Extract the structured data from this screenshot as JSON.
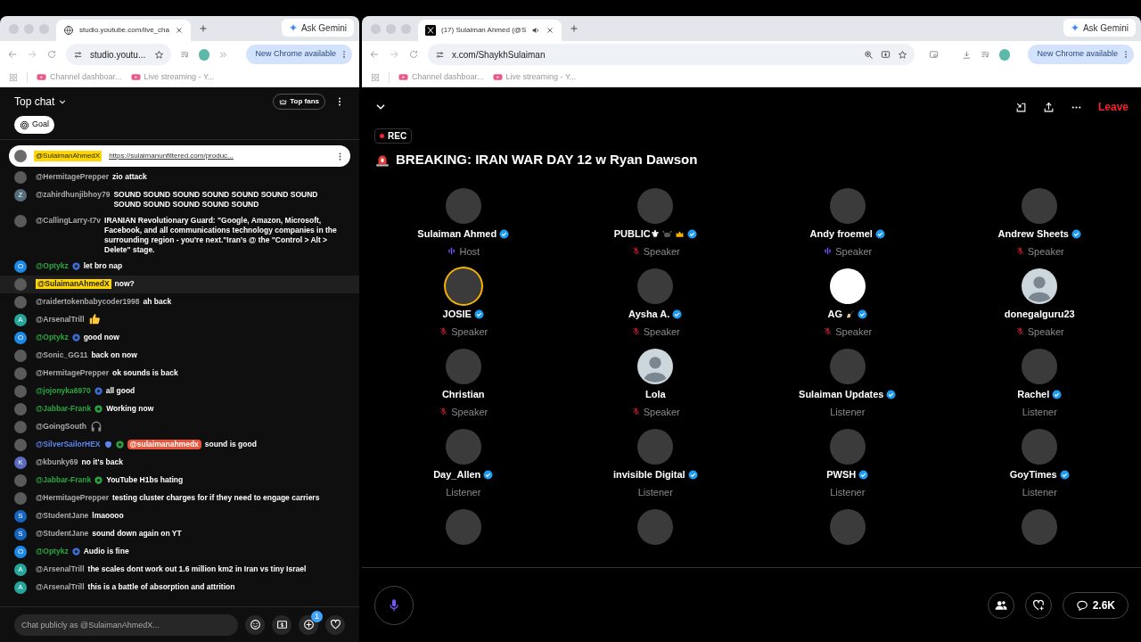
{
  "left_window": {
    "tab_title": "studio.youtube.com/live_cha",
    "ask_gemini": "Ask Gemini",
    "address": "studio.youtu...",
    "update_button": "New Chrome available",
    "bookmarks": [
      "Channel dashboar...",
      "Live streaming - Y..."
    ]
  },
  "chat": {
    "title": "Top chat",
    "top_fans": "Top fans",
    "goal": "Goal",
    "pinned": {
      "author": "@SulaimanAhmedX",
      "link": "https://sulaimanunfiltered.com/produc..."
    },
    "messages": [
      {
        "author": "@HermitagePrepper",
        "kind": "viewer",
        "avatar": {
          "kind": "photo"
        },
        "text": "zio attack"
      },
      {
        "author": "@zahirdhunjibhoy79",
        "kind": "viewer",
        "avatar": {
          "kind": "letter",
          "letter": "Z",
          "color": "#546e7a"
        },
        "text": "SOUND SOUND SOUND SOUND SOUND SOUND SOUND SOUND SOUND SOUND SOUND SOUND"
      },
      {
        "author": "@CallingLarry-t7v",
        "kind": "viewer",
        "avatar": {
          "kind": "photo"
        },
        "text": "IRANIAN Revolutionary Guard: \"Google, Amazon, Microsoft, Facebook, and all communications technology companies in the surrounding region - you're next.\"Iran's @ the \"Control > Alt > Delete\" stage."
      },
      {
        "author": "@Optykz",
        "kind": "member",
        "avatar": {
          "kind": "letter",
          "letter": "O",
          "color": "#1e88e5"
        },
        "badges": [
          {
            "kind": "member",
            "color": "#3d6fd6"
          }
        ],
        "text": "let bro nap"
      },
      {
        "author": "@SulaimanAhmedX",
        "kind": "owner",
        "avatar": {
          "kind": "photo"
        },
        "text": "now?"
      },
      {
        "author": "@raidertokenbabycoder1998",
        "kind": "viewer",
        "avatar": {
          "kind": "photo"
        },
        "text": "ah back"
      },
      {
        "author": "@ArsenalTrill",
        "kind": "viewer",
        "avatar": {
          "kind": "letter",
          "letter": "A",
          "color": "#26a69a"
        },
        "emoji": {
          "kind": "thumbs_up"
        }
      },
      {
        "author": "@Optykz",
        "kind": "member",
        "avatar": {
          "kind": "letter",
          "letter": "O",
          "color": "#1e88e5"
        },
        "badges": [
          {
            "kind": "member",
            "color": "#3d6fd6"
          }
        ],
        "text": "good now"
      },
      {
        "author": "@Sonic_GG11",
        "kind": "viewer",
        "avatar": {
          "kind": "photo"
        },
        "text": "back on now"
      },
      {
        "author": "@HermitagePrepper",
        "kind": "viewer",
        "avatar": {
          "kind": "photo"
        },
        "text": "ok sounds is back"
      },
      {
        "author": "@jojonyka6970",
        "kind": "member",
        "avatar": {
          "kind": "photo"
        },
        "badges": [
          {
            "kind": "member",
            "color": "#3d6fd6"
          }
        ],
        "text": "all good"
      },
      {
        "author": "@Jabbar-Frank",
        "kind": "member",
        "avatar": {
          "kind": "photo"
        },
        "badges": [
          {
            "kind": "member",
            "color": "#2ba640"
          }
        ],
        "text": "Working now"
      },
      {
        "author": "@GoingSouth",
        "kind": "viewer",
        "avatar": {
          "kind": "photo"
        },
        "emoji": {
          "kind": "headphones"
        }
      },
      {
        "author": "@SilverSailorHEX",
        "kind": "moderator",
        "avatar": {
          "kind": "photo"
        },
        "badges": [
          {
            "kind": "moderator",
            "color": "#5e84f1"
          },
          {
            "kind": "member",
            "color": "#2ba640"
          }
        ],
        "mention": "@sulaimanahmedx",
        "text": "sound is good"
      },
      {
        "author": "@kbunky69",
        "kind": "viewer",
        "avatar": {
          "kind": "letter",
          "letter": "K",
          "color": "#5c6bc0"
        },
        "text": "no it's back"
      },
      {
        "author": "@Jabbar-Frank",
        "kind": "member",
        "avatar": {
          "kind": "photo"
        },
        "badges": [
          {
            "kind": "member",
            "color": "#2ba640"
          }
        ],
        "text": "YouTube H1bs hating"
      },
      {
        "author": "@HermitagePrepper",
        "kind": "viewer",
        "avatar": {
          "kind": "photo"
        },
        "text": "testing cluster charges for if they need to engage carriers"
      },
      {
        "author": "@StudentJane",
        "kind": "viewer",
        "avatar": {
          "kind": "letter",
          "letter": "S",
          "color": "#1565c0"
        },
        "text": "lmaoooo"
      },
      {
        "author": "@StudentJane",
        "kind": "viewer",
        "avatar": {
          "kind": "letter",
          "letter": "S",
          "color": "#1565c0"
        },
        "text": "sound down again on YT"
      },
      {
        "author": "@Optykz",
        "kind": "member",
        "avatar": {
          "kind": "letter",
          "letter": "O",
          "color": "#1e88e5"
        },
        "badges": [
          {
            "kind": "member",
            "color": "#3d6fd6"
          }
        ],
        "text": "Audio is fine"
      },
      {
        "author": "@ArsenalTrill",
        "kind": "viewer",
        "avatar": {
          "kind": "letter",
          "letter": "A",
          "color": "#26a69a"
        },
        "text": "the scales dont work out 1.6 million km2 in Iran vs tiny Israel"
      },
      {
        "author": "@ArsenalTrill",
        "kind": "viewer",
        "avatar": {
          "kind": "letter",
          "letter": "A",
          "color": "#26a69a"
        },
        "text": "this is a battle of absorption and attrition"
      }
    ],
    "input": {
      "placeholder": "Chat publicly as @SulaimanAhmedX..."
    },
    "supers_badge": "1"
  },
  "right_window": {
    "tab_title": "(17) Sulaiman Ahmed (@S",
    "ask_gemini": "Ask Gemini",
    "address": "x.com/ShaykhSulaiman",
    "update_button": "New Chrome available",
    "bookmarks": [
      "Channel dashboar...",
      "Live streaming - Y..."
    ]
  },
  "space": {
    "leave": "Leave",
    "rec": "REC",
    "title": "BREAKING: IRAN WAR DAY 12 w Ryan Dawson",
    "participants": [
      {
        "name": "Sulaiman Ahmed",
        "verified": true,
        "avatar": {
          "kind": "photo"
        },
        "role": "Host",
        "kind": "speaking"
      },
      {
        "name": "PUBLIC⚜",
        "emojis": [
          {
            "kind": "ox"
          },
          {
            "kind": "crown"
          }
        ],
        "verified": true,
        "avatar": {
          "kind": "photo"
        },
        "role": "Speaker",
        "kind": "muted"
      },
      {
        "name": "Andy froemel",
        "verified": true,
        "avatar": {
          "kind": "photo"
        },
        "role": "Speaker",
        "kind": "speaking"
      },
      {
        "name": "Andrew Sheets",
        "verified": true,
        "avatar": {
          "kind": "photo"
        },
        "role": "Speaker",
        "kind": "muted"
      },
      {
        "name": "JOSIE",
        "verified": true,
        "avatar": {
          "kind": "photo",
          "ring": true
        },
        "role": "Speaker",
        "kind": "muted"
      },
      {
        "name": "Aysha A.",
        "verified": true,
        "avatar": {
          "kind": "photo"
        },
        "role": "Speaker",
        "kind": "muted"
      },
      {
        "name": "AG",
        "emojis": [
          {
            "kind": "writing_hand"
          }
        ],
        "verified": true,
        "avatar": {
          "kind": "blank"
        },
        "role": "Speaker",
        "kind": "muted"
      },
      {
        "name": "donegalguru23",
        "verified": false,
        "avatar": {
          "kind": "default"
        },
        "role": "Speaker",
        "kind": "muted"
      },
      {
        "name": "Christian",
        "verified": false,
        "avatar": {
          "kind": "photo"
        },
        "role": "Speaker",
        "kind": "muted"
      },
      {
        "name": "Lola",
        "verified": false,
        "avatar": {
          "kind": "default"
        },
        "role": "Speaker",
        "kind": "muted"
      },
      {
        "name": "Sulaiman Updates",
        "verified": true,
        "avatar": {
          "kind": "photo"
        },
        "role": "Listener",
        "kind": "listener"
      },
      {
        "name": "Rachel",
        "verified": true,
        "avatar": {
          "kind": "photo"
        },
        "role": "Listener",
        "kind": "listener"
      },
      {
        "name": "Day_Allen",
        "verified": true,
        "avatar": {
          "kind": "photo"
        },
        "role": "Listener",
        "kind": "listener"
      },
      {
        "name": "invisible Digital",
        "verified": true,
        "avatar": {
          "kind": "photo"
        },
        "role": "Listener",
        "kind": "listener"
      },
      {
        "name": "PWSH",
        "verified": true,
        "avatar": {
          "kind": "photo"
        },
        "role": "Listener",
        "kind": "listener"
      },
      {
        "name": "GoyTimes",
        "verified": true,
        "avatar": {
          "kind": "photo"
        },
        "role": "Listener",
        "kind": "listener"
      },
      {
        "avatar": {
          "kind": "photo"
        }
      },
      {
        "avatar": {
          "kind": "photo"
        }
      },
      {
        "avatar": {
          "kind": "photo"
        }
      },
      {
        "avatar": {
          "kind": "photo"
        }
      }
    ],
    "comments_count": "2.6K"
  }
}
